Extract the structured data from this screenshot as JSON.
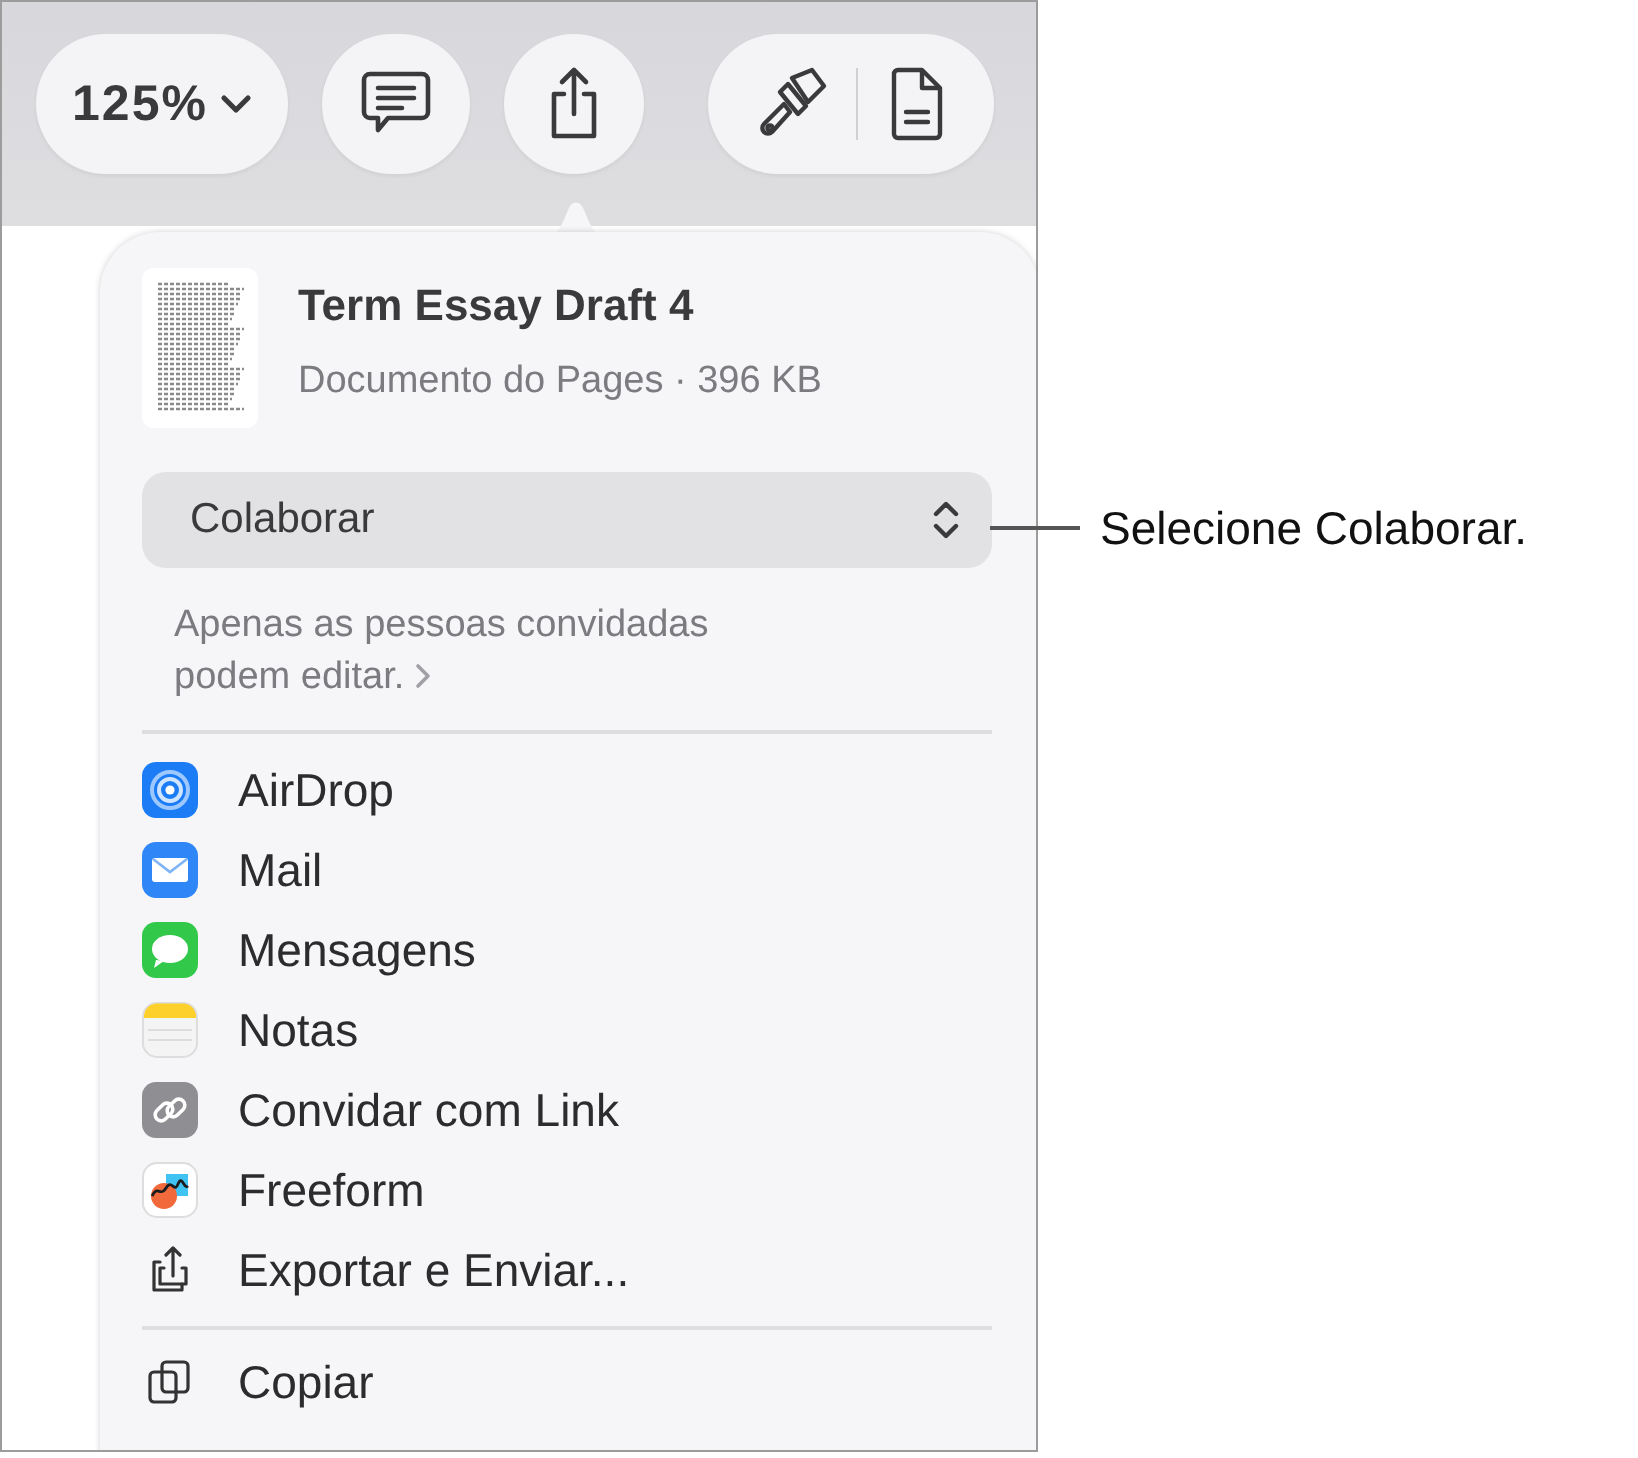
{
  "toolbar": {
    "zoom_button": "125%"
  },
  "share_popover": {
    "document": {
      "title": "Term Essay Draft 4",
      "subtitle": "Documento do Pages · 396 KB"
    },
    "mode_popup": "Colaborar",
    "permission_note": "Apenas as pessoas convidadas podem editar.",
    "share_options": [
      {
        "label": "AirDrop",
        "kind": "airdrop"
      },
      {
        "label": "Mail",
        "kind": "mail"
      },
      {
        "label": "Mensagens",
        "kind": "messages"
      },
      {
        "label": "Notas",
        "kind": "notes"
      },
      {
        "label": "Convidar com Link",
        "kind": "link"
      },
      {
        "label": "Freeform",
        "kind": "freeform"
      },
      {
        "label": "Exportar e Enviar...",
        "kind": "export"
      }
    ],
    "more_options": [
      {
        "label": "Copiar",
        "kind": "copy"
      }
    ]
  },
  "callout": "Selecione Colaborar."
}
